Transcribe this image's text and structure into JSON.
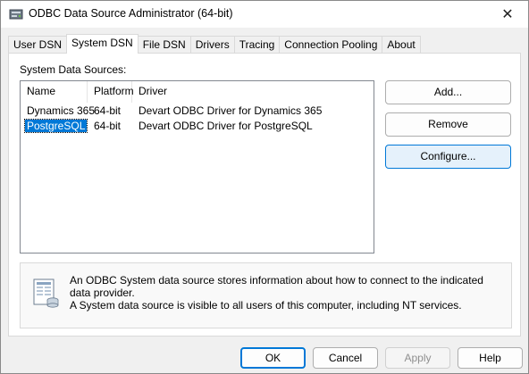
{
  "window": {
    "title": "ODBC Data Source Administrator (64-bit)",
    "close_glyph": "✕",
    "icon": "odbc-admin-icon"
  },
  "tabs": [
    {
      "label": "User DSN"
    },
    {
      "label": "System DSN",
      "active": true
    },
    {
      "label": "File DSN"
    },
    {
      "label": "Drivers"
    },
    {
      "label": "Tracing"
    },
    {
      "label": "Connection Pooling"
    },
    {
      "label": "About"
    }
  ],
  "system_dsn": {
    "section_label": "System Data Sources:",
    "columns": [
      "Name",
      "Platform",
      "Driver"
    ],
    "rows": [
      {
        "name": "Dynamics 365",
        "platform": "64-bit",
        "driver": "Devart ODBC Driver for Dynamics 365"
      },
      {
        "name": "PostgreSQL",
        "platform": "64-bit",
        "driver": "Devart ODBC Driver for PostgreSQL",
        "selected": true
      }
    ],
    "buttons": {
      "add": "Add...",
      "remove": "Remove",
      "configure": "Configure..."
    },
    "info": {
      "line1": "An ODBC System data source stores information about how to connect to the indicated data provider.",
      "line2": "A System data source is visible to all users of this computer, including NT services.",
      "icon": "data-source-info-icon"
    }
  },
  "footer": {
    "ok": "OK",
    "cancel": "Cancel",
    "apply": "Apply",
    "help": "Help"
  },
  "colors": {
    "selection": "#0078d7",
    "focus_button_bg": "#e5f1fb",
    "window_bg": "#f0f0f0"
  }
}
